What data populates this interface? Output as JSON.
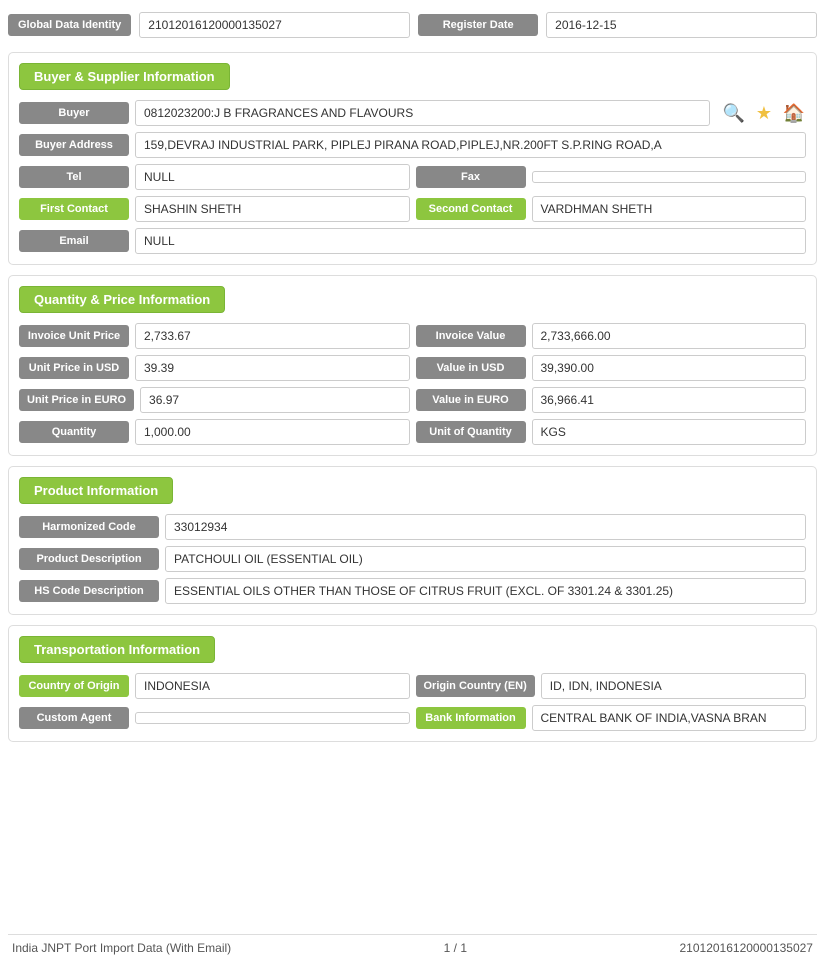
{
  "topBar": {
    "globalDataIdentityLabel": "Global Data Identity",
    "globalDataIdentityValue": "21012016120000135027",
    "registerDateLabel": "Register Date",
    "registerDateValue": "2016-12-15"
  },
  "buyerSupplier": {
    "sectionTitle": "Buyer & Supplier Information",
    "buyerLabel": "Buyer",
    "buyerValue": "0812023200:J B FRAGRANCES AND FLAVOURS",
    "buyerAddressLabel": "Buyer Address",
    "buyerAddressValue": "159,DEVRAJ INDUSTRIAL PARK, PIPLEJ PIRANA ROAD,PIPLEJ,NR.200FT S.P.RING ROAD,A",
    "telLabel": "Tel",
    "telValue": "NULL",
    "faxLabel": "Fax",
    "faxValue": "",
    "firstContactLabel": "First Contact",
    "firstContactValue": "SHASHIN SHETH",
    "secondContactLabel": "Second Contact",
    "secondContactValue": "VARDHMAN SHETH",
    "emailLabel": "Email",
    "emailValue": "NULL"
  },
  "quantityPrice": {
    "sectionTitle": "Quantity & Price Information",
    "invoiceUnitPriceLabel": "Invoice Unit Price",
    "invoiceUnitPriceValue": "2,733.67",
    "invoiceValueLabel": "Invoice Value",
    "invoiceValueValue": "2,733,666.00",
    "unitPriceUSDLabel": "Unit Price in USD",
    "unitPriceUSDValue": "39.39",
    "valueUSDLabel": "Value in USD",
    "valueUSDValue": "39,390.00",
    "unitPriceEUROLabel": "Unit Price in EURO",
    "unitPriceEUROValue": "36.97",
    "valueEUROLabel": "Value in EURO",
    "valueEUROValue": "36,966.41",
    "quantityLabel": "Quantity",
    "quantityValue": "1,000.00",
    "unitOfQuantityLabel": "Unit of Quantity",
    "unitOfQuantityValue": "KGS"
  },
  "productInfo": {
    "sectionTitle": "Product Information",
    "harmonizedCodeLabel": "Harmonized Code",
    "harmonizedCodeValue": "33012934",
    "productDescriptionLabel": "Product Description",
    "productDescriptionValue": "PATCHOULI OIL (ESSENTIAL OIL)",
    "hsCodeDescriptionLabel": "HS Code Description",
    "hsCodeDescriptionValue": "ESSENTIAL OILS OTHER THAN THOSE OF CITRUS FRUIT (EXCL. OF 3301.24 & 3301.25)"
  },
  "transportInfo": {
    "sectionTitle": "Transportation Information",
    "countryOfOriginLabel": "Country of Origin",
    "countryOfOriginValue": "INDONESIA",
    "originCountryENLabel": "Origin Country (EN)",
    "originCountryENValue": "ID, IDN, INDONESIA",
    "customAgentLabel": "Custom Agent",
    "customAgentValue": "",
    "bankInformationLabel": "Bank Information",
    "bankInformationValue": "CENTRAL BANK OF INDIA,VASNA BRAN"
  },
  "footer": {
    "leftText": "India JNPT Port Import Data (With Email)",
    "centerText": "1 / 1",
    "rightText": "21012016120000135027"
  },
  "icons": {
    "search": "🔍",
    "star": "★",
    "home": "🏠"
  }
}
